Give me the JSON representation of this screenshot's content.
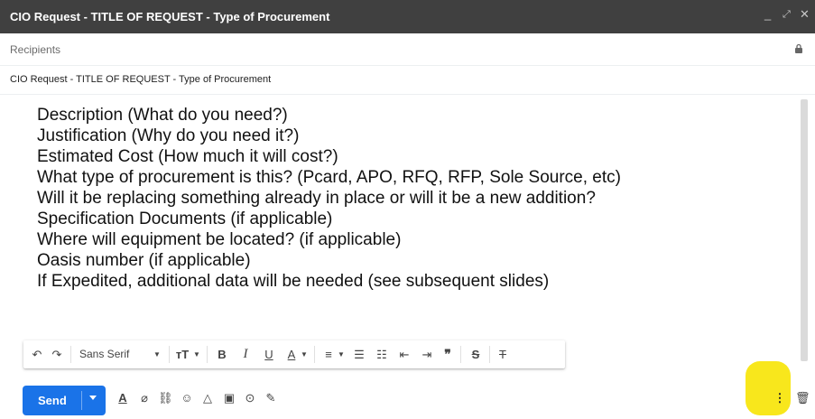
{
  "window": {
    "title": "CIO Request - TITLE OF REQUEST - Type of Procurement",
    "controls": {
      "minimize": "_",
      "fullscreen": "⤢",
      "close": "✕"
    }
  },
  "recipients": {
    "placeholder": "Recipients"
  },
  "subject": {
    "value": "CIO Request - TITLE OF REQUEST - Type of Procurement"
  },
  "body": {
    "lines": [
      "Description (What do you need?)",
      "Justification (Why do you need it?)",
      "Estimated Cost (How much it will cost?)",
      "What type of procurement is this? (Pcard, APO, RFQ, RFP, Sole Source, etc)",
      "Will it be replacing something already in place or will it be a new addition?",
      "Specification Documents (if applicable)",
      "Where will equipment be located? (if applicable)",
      "Oasis number (if applicable)",
      "If Expedited, additional data will be needed (see subsequent slides)"
    ]
  },
  "formatting": {
    "font_label": "Sans Serif",
    "icons": [
      "undo-icon",
      "redo-icon",
      "font-family-select",
      "text-size-icon",
      "bold-icon",
      "italic-icon",
      "underline-icon",
      "text-color-icon",
      "align-icon",
      "numbered-list-icon",
      "bulleted-list-icon",
      "indent-less-icon",
      "indent-more-icon",
      "quote-icon",
      "strikethrough-icon",
      "remove-formatting-icon"
    ]
  },
  "footer": {
    "send_label": "Send",
    "icons": [
      "formatting-options-icon",
      "attach-icon",
      "link-icon",
      "emoji-icon",
      "drive-icon",
      "photo-icon",
      "confidential-icon",
      "signature-icon",
      "more-options-icon",
      "discard-icon"
    ],
    "highlight_color": "#f8e71c"
  },
  "colors": {
    "titlebar": "#404040",
    "send": "#1a73e8"
  }
}
